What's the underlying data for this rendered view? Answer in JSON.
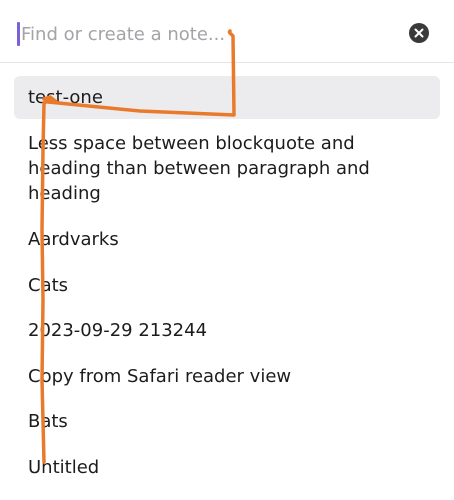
{
  "search": {
    "placeholder": "Find or create a note...",
    "value": ""
  },
  "results": [
    {
      "title": "test-one"
    },
    {
      "title": "Less space between blockquote and heading than between paragraph and heading"
    },
    {
      "title": "Aardvarks"
    },
    {
      "title": "Cats"
    },
    {
      "title": "2023-09-29 213244"
    },
    {
      "title": "Copy from Safari reader view"
    },
    {
      "title": "Bats"
    },
    {
      "title": "Untitled"
    }
  ],
  "colors": {
    "caret": "#7b61d8",
    "selected_background": "#ececee",
    "annotation_stroke": "#e97a2c"
  },
  "icons": {
    "clear": "close-circle-icon"
  }
}
